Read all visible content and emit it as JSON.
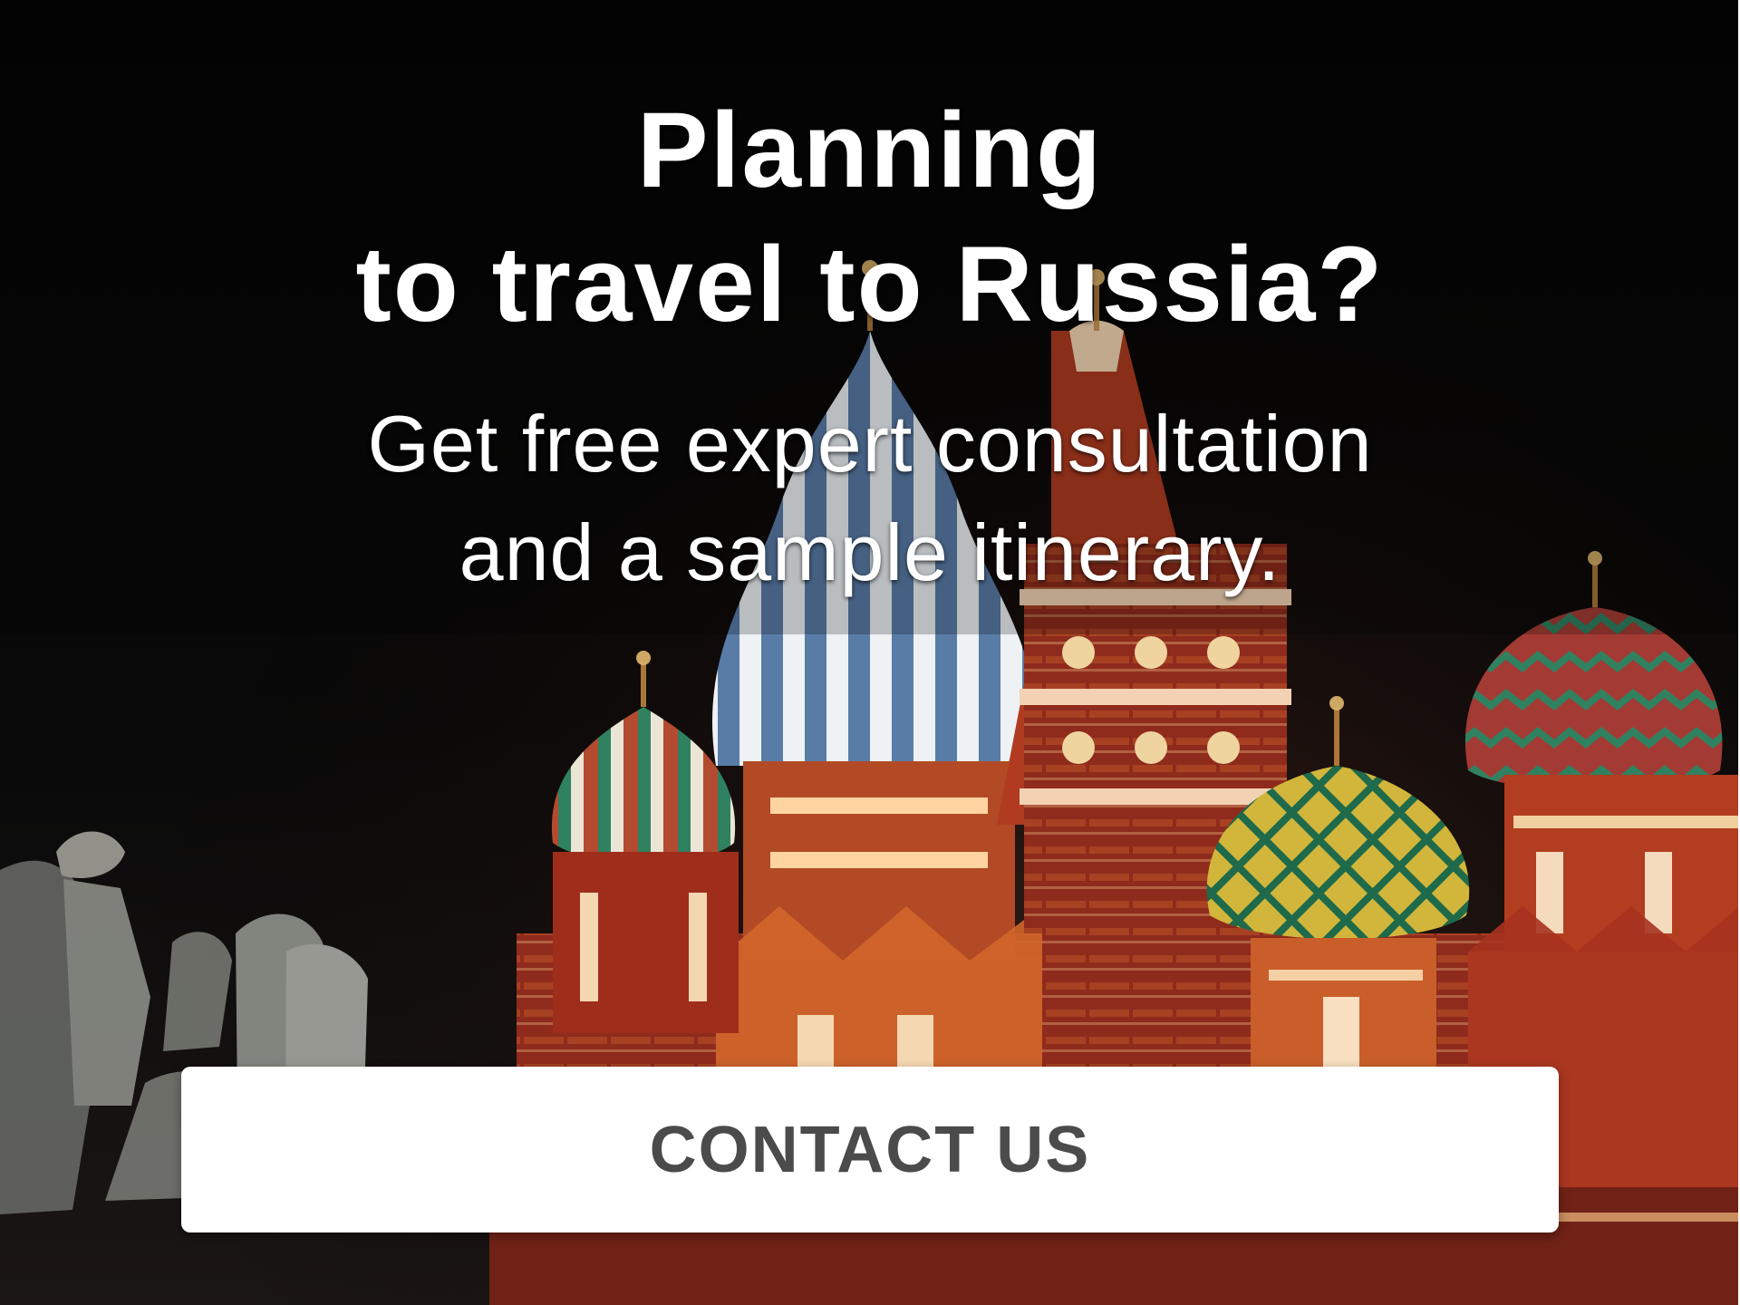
{
  "banner": {
    "headline_line_1": "Planning",
    "headline_line_2": "to travel to Russia?",
    "subline_line_1": "Get free expert consultation",
    "subline_line_2": "and a sample itinerary.",
    "cta_label": "CONTACT US"
  },
  "colors": {
    "night_sky": "#050505",
    "brick_red": "#9b2e1f",
    "accent_orange": "#d56a2e",
    "dome_blue": "#597ca7",
    "dome_green": "#2f8160",
    "dome_yellow": "#d1b63b",
    "cta_background": "#ffffff",
    "cta_text": "#4b4b4b"
  }
}
